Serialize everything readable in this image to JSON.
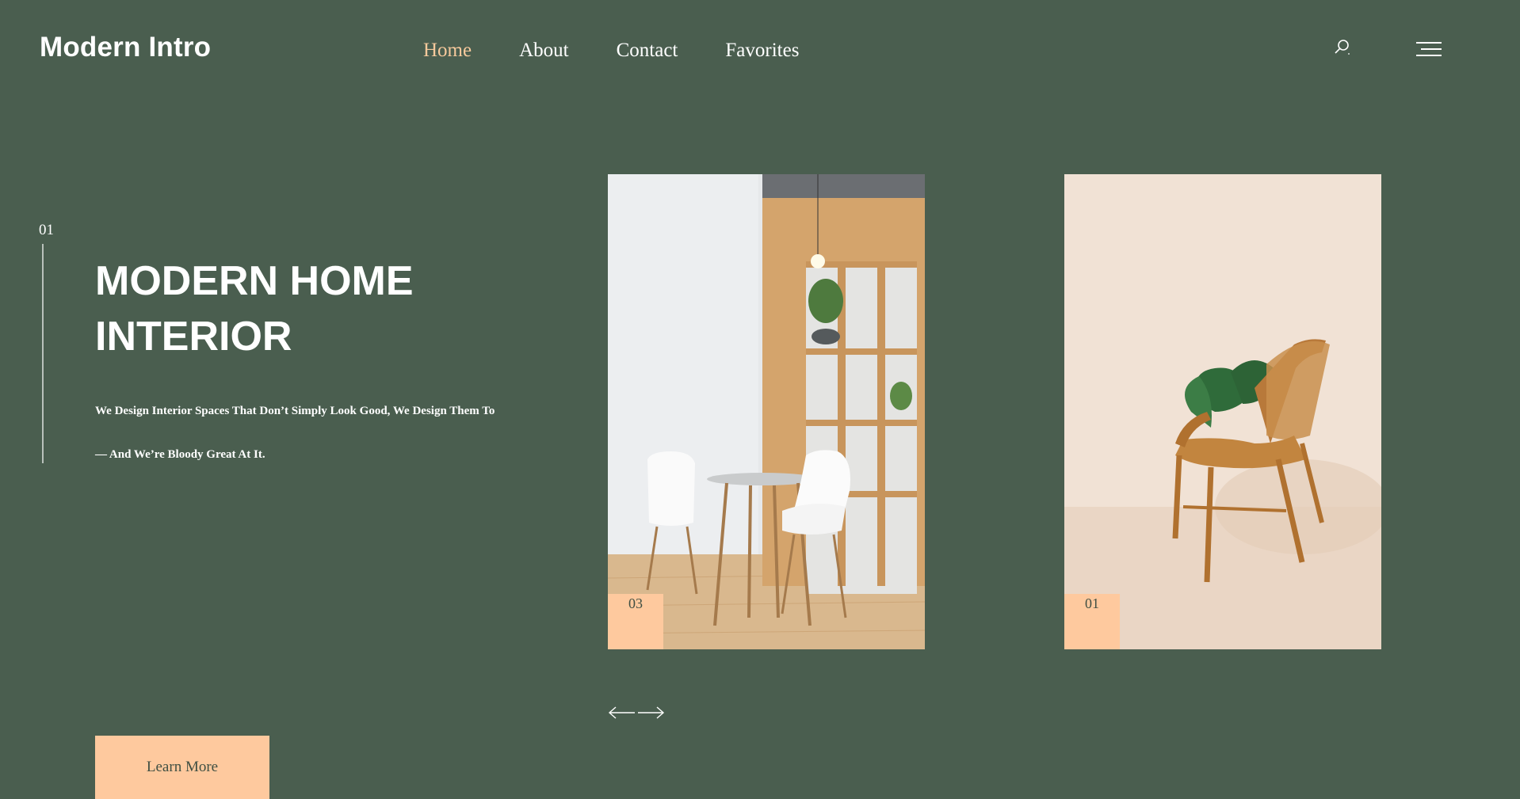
{
  "brand": {
    "name": "Modern Intro"
  },
  "nav": {
    "items": [
      {
        "label": "Home",
        "active": true
      },
      {
        "label": "About"
      },
      {
        "label": "Contact"
      },
      {
        "label": "Favorites"
      }
    ]
  },
  "header_icons": {
    "search": "search-icon",
    "menu": "hamburger-menu-icon"
  },
  "hero": {
    "index": "01",
    "title": "MODERN HOME INTERIOR",
    "subtitle": "We Design Interior Spaces That Don’t Simply Look Good, We Design Them To",
    "tagline": "— And We’re Bloody Great At It.",
    "button_label": "Learn More"
  },
  "slides": [
    {
      "number": "03",
      "image": "dining-table-white-chairs"
    },
    {
      "number": "01",
      "image": "rattan-armchair-monstera"
    }
  ],
  "slider_controls": {
    "prev": "arrow-left-icon",
    "next": "arrow-right-icon"
  },
  "colors": {
    "background": "#4a5e4f",
    "accent": "#fec99e",
    "active_nav": "#f6c99c",
    "text": "#ffffff"
  }
}
